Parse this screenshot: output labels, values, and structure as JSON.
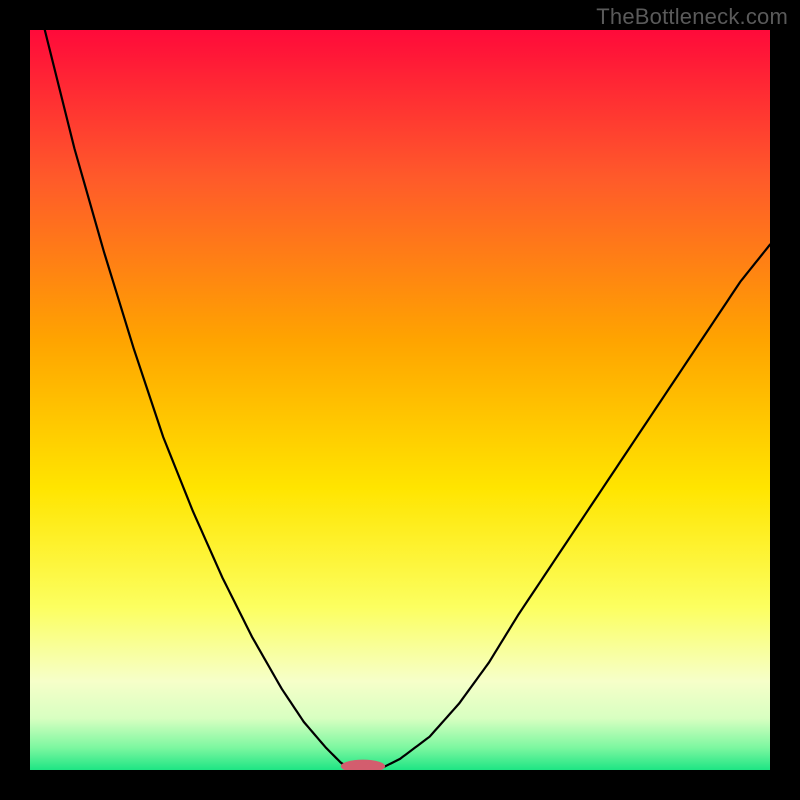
{
  "watermark": "TheBottleneck.com",
  "chart_data": {
    "type": "line",
    "title": "",
    "xlabel": "",
    "ylabel": "",
    "xlim": [
      0,
      100
    ],
    "ylim": [
      0,
      100
    ],
    "grid": false,
    "background_gradient": {
      "stops": [
        {
          "offset": 0.0,
          "color": "#ff0a3a"
        },
        {
          "offset": 0.2,
          "color": "#ff5a2a"
        },
        {
          "offset": 0.42,
          "color": "#ffa400"
        },
        {
          "offset": 0.62,
          "color": "#ffe500"
        },
        {
          "offset": 0.78,
          "color": "#fcff60"
        },
        {
          "offset": 0.88,
          "color": "#f6ffc9"
        },
        {
          "offset": 0.93,
          "color": "#d8ffc1"
        },
        {
          "offset": 0.97,
          "color": "#7cf7a0"
        },
        {
          "offset": 1.0,
          "color": "#1ee584"
        }
      ]
    },
    "series": [
      {
        "name": "left-curve",
        "x": [
          2,
          6,
          10,
          14,
          18,
          22,
          26,
          30,
          34,
          37,
          40,
          42,
          43.5
        ],
        "y": [
          100,
          84,
          70,
          57,
          45,
          35,
          26,
          18,
          11,
          6.5,
          3,
          1,
          0
        ]
      },
      {
        "name": "right-curve",
        "x": [
          47,
          50,
          54,
          58,
          62,
          66,
          72,
          78,
          84,
          90,
          96,
          100
        ],
        "y": [
          0,
          1.5,
          4.5,
          9,
          14.5,
          21,
          30,
          39,
          48,
          57,
          66,
          71
        ]
      }
    ],
    "marker": {
      "cx": 45,
      "cy": 0.5,
      "rx": 3.0,
      "ry": 0.9,
      "fill": "#d35d6e"
    }
  }
}
